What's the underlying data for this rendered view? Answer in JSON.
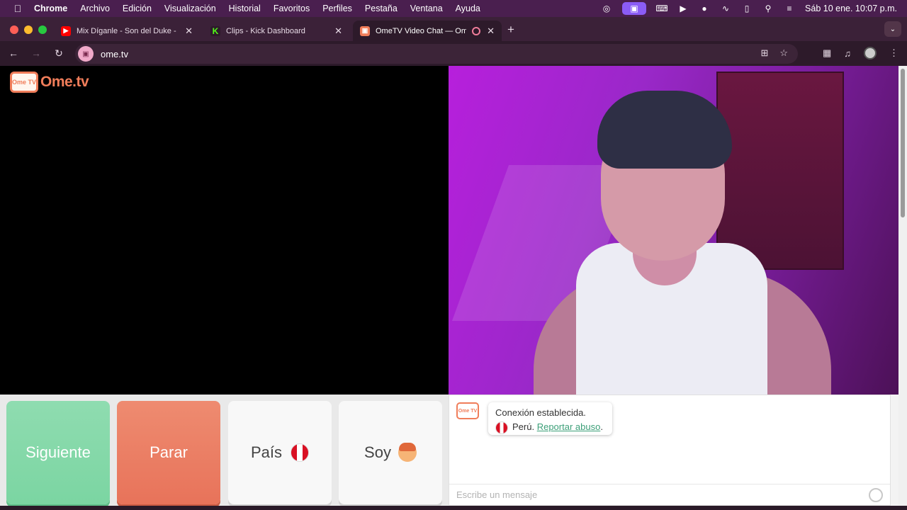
{
  "menubar": {
    "app": "Chrome",
    "items": [
      "Archivo",
      "Edición",
      "Visualización",
      "Historial",
      "Favoritos",
      "Perfiles",
      "Pestaña",
      "Ventana",
      "Ayuda"
    ],
    "datetime": "Sáb 10 ene.  10:07 p.m."
  },
  "tabs": [
    {
      "title": "Mix Díganle - Son del Duke -",
      "favicon": "youtube-icon"
    },
    {
      "title": "Clips - Kick Dashboard",
      "favicon": "kick-icon"
    },
    {
      "title": "OmeTV Video Chat — Om",
      "favicon": "ometv-icon",
      "active": true
    }
  ],
  "toolbar": {
    "url": "ome.tv"
  },
  "page": {
    "logo_badge": "Ome TV",
    "logo_text": "Ome.tv",
    "controls": {
      "next_label": "Siguiente",
      "stop_label": "Parar",
      "country_label": "País",
      "gender_label": "Soy"
    },
    "chat": {
      "logo_badge": "Ome TV",
      "status": "Conexión establecida.",
      "country": "Perú.",
      "report_link": "Reportar abuso",
      "report_suffix": ".",
      "input_placeholder": "Escribe un mensaje"
    }
  },
  "colors": {
    "next": "#7bd5a2",
    "stop": "#e8735a",
    "brand": "#f07d5a",
    "link": "#3c9f78"
  }
}
